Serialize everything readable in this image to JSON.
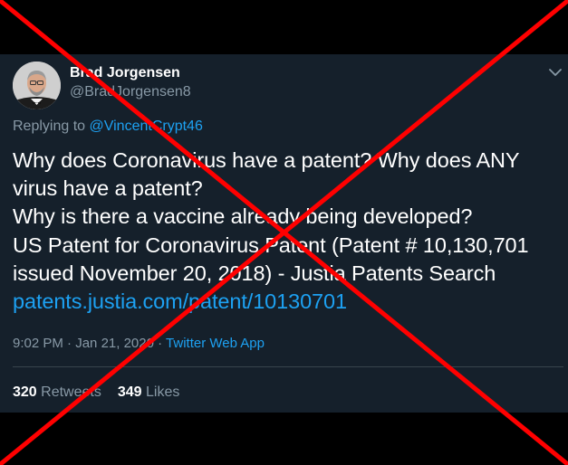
{
  "tweet": {
    "author": {
      "display_name": "Brad Jorgensen",
      "handle": "@BradJorgensen8",
      "avatar_icon": "person-avatar"
    },
    "menu_icon": "chevron-down-icon",
    "reply_prefix": "Replying to ",
    "reply_to": "@VincentCrypt46",
    "text_lines": [
      "Why does Coronavirus have a patent? Why does ANY",
      "virus have a patent?",
      "Why is there a vaccine already being developed?",
      "US Patent for Coronavirus Patent (Patent # 10,130,701",
      "issued November 20, 2018) - Justia Patents Search"
    ],
    "link_text": "patents.justia.com/patent/10130701",
    "time": "9:02 PM",
    "meta_separator": " · ",
    "date": "Jan 21, 2020",
    "source": "Twitter Web App",
    "retweets": {
      "count": "320",
      "label": " Retweets"
    },
    "likes": {
      "count": "349",
      "label": " Likes"
    }
  },
  "overlay": {
    "icon": "red-x-cross",
    "color": "#ff0000"
  },
  "colors": {
    "background": "#15202b",
    "accent": "#1da1f2",
    "secondary_text": "#8899a6",
    "primary_text": "#ffffff"
  }
}
